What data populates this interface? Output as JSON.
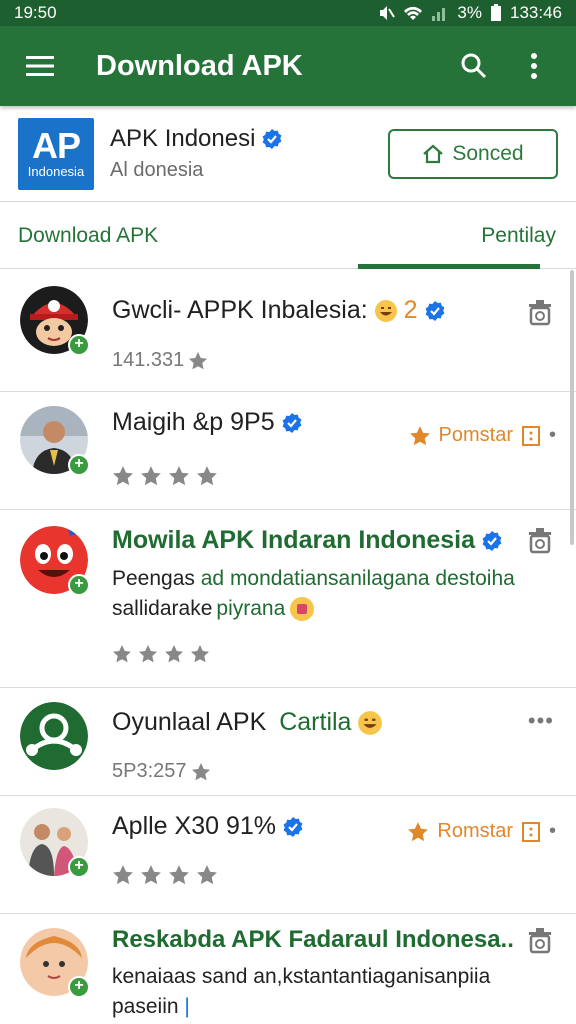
{
  "status_bar": {
    "time": "19:50",
    "battery": "3%",
    "clock": "133:46"
  },
  "app_bar": {
    "title": "Download APK"
  },
  "developer": {
    "logo_big": "AP",
    "logo_small": "Indonesia",
    "name": "APK Indonesi",
    "subtitle": "Al donesia",
    "follow_label": "Sonced"
  },
  "tabs": [
    {
      "label": "Download APK"
    },
    {
      "label": "Pentilay"
    }
  ],
  "items": [
    {
      "title": "Gwcli- APPK Inbalesia:",
      "title_suffix": "2",
      "count": "141.331"
    },
    {
      "title": "Maigih &p 9P5",
      "badge_label": "Pomstar"
    },
    {
      "title": "Mowila APK Indaran Indonesia",
      "desc_part1": "Peengas ",
      "desc_part2": "ad mondatiansanilagana destoiha",
      "desc_part3": "sallidarake ",
      "desc_part4": "piyrana"
    },
    {
      "title_part1": "Oyunlaal APK ",
      "title_part2": "Cartila",
      "count": "5P3:257"
    },
    {
      "title": "Aplle X30 91%",
      "badge_label": "Romstar"
    },
    {
      "title": "Reskabda APK Fadaraul Indonesa..",
      "desc_line1": "kenaiaas sand an,kstantantiaganisanpiia",
      "desc_line2": "paseiin"
    }
  ],
  "colors": {
    "app_bar": "#26733a",
    "status_bar": "#1e5f2f",
    "accent": "#26733a",
    "verified": "#1a73e8",
    "pomstar": "#e0882a"
  }
}
